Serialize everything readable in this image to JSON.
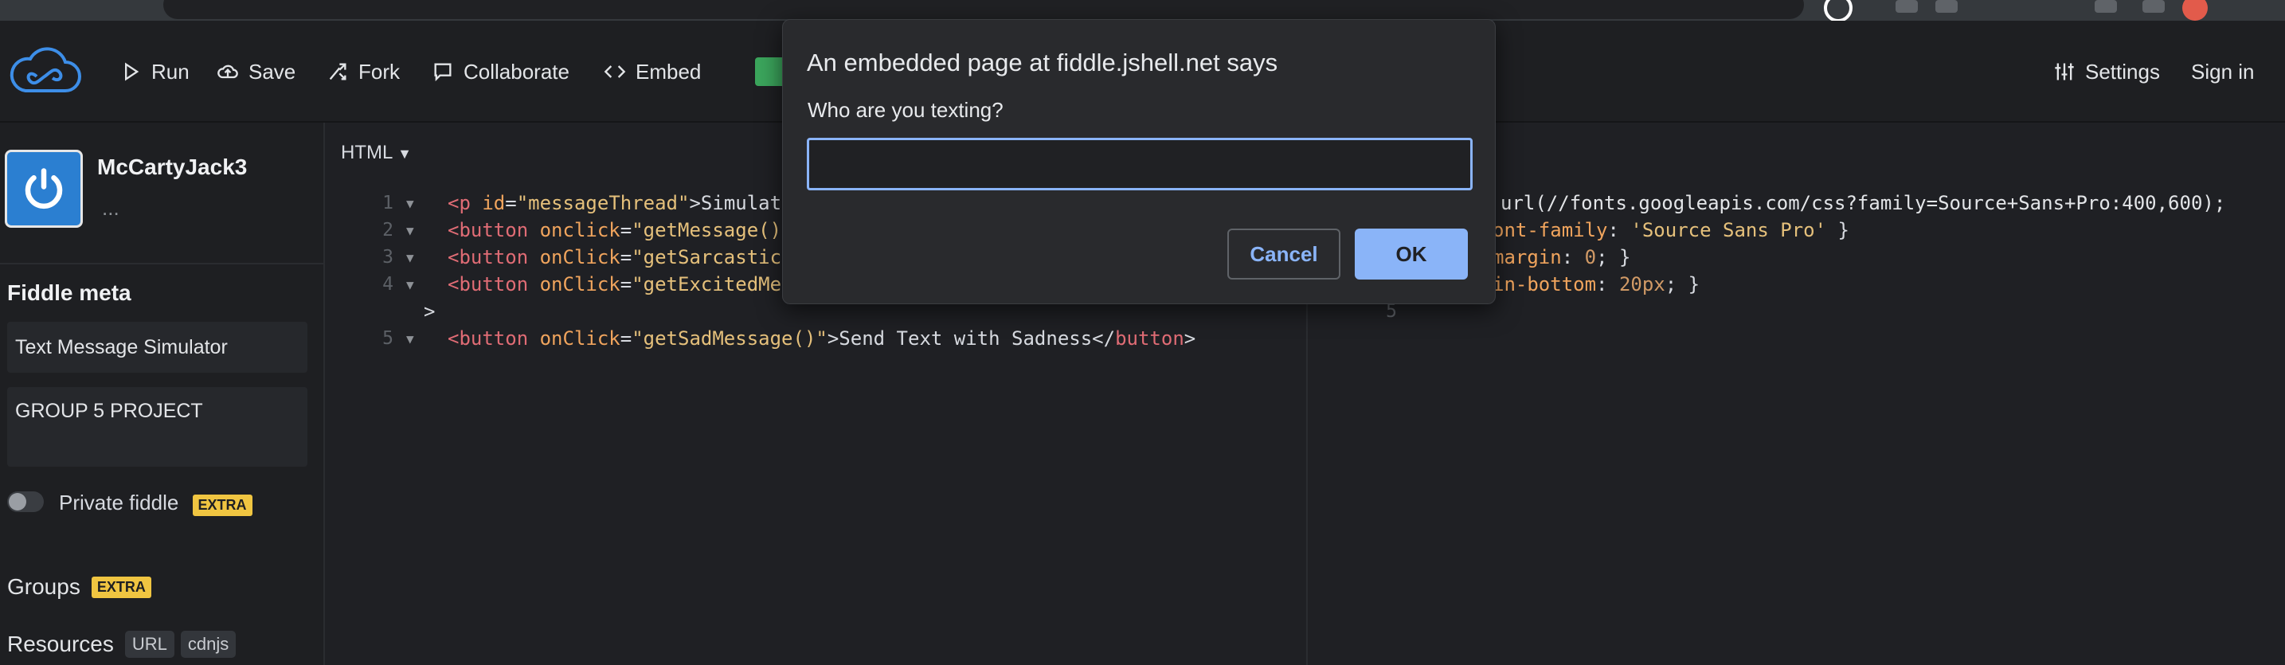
{
  "toolbar": {
    "run": "Run",
    "save": "Save",
    "fork": "Fork",
    "collaborate": "Collaborate",
    "embed": "Embed",
    "settings": "Settings",
    "sign_in": "Sign in"
  },
  "sidebar": {
    "username": "McCartyJack3",
    "user_dots": "...",
    "meta_heading": "Fiddle meta",
    "title_value": "Text Message Simulator",
    "description_value": "GROUP 5 PROJECT",
    "private_label": "Private fiddle",
    "extra_badge": "EXTRA",
    "groups_label": "Groups",
    "resources_label": "Resources",
    "resource_chips": [
      "URL",
      "cdnjs"
    ]
  },
  "html_panel": {
    "label": "HTML",
    "lines": [
      {
        "n": "1",
        "segments": [
          [
            "tag",
            "<p"
          ],
          [
            "attr",
            " id"
          ],
          [
            "txt",
            "="
          ],
          [
            "str",
            "\"messageThread\""
          ],
          [
            "txt",
            ">Simulat"
          ]
        ]
      },
      {
        "n": "2",
        "segments": [
          [
            "tag",
            "<button"
          ],
          [
            "attr",
            " onclick"
          ],
          [
            "txt",
            "="
          ],
          [
            "str",
            "\"getMessage()"
          ]
        ]
      },
      {
        "n": "3",
        "segments": [
          [
            "tag",
            "<button"
          ],
          [
            "attr",
            " onClick"
          ],
          [
            "txt",
            "="
          ],
          [
            "str",
            "\"getSarcastic"
          ]
        ]
      },
      {
        "n": "4",
        "segments": [
          [
            "tag",
            "<button"
          ],
          [
            "attr",
            " onClick"
          ],
          [
            "txt",
            "="
          ],
          [
            "str",
            "\"getExcitedMe"
          ]
        ]
      },
      {
        "n": "",
        "segments": [
          [
            "txt",
            ">"
          ]
        ]
      },
      {
        "n": "5",
        "segments": [
          [
            "tag",
            "<button"
          ],
          [
            "attr",
            " onClick"
          ],
          [
            "txt",
            "="
          ],
          [
            "str",
            "\"getSadMessage()\""
          ],
          [
            "txt",
            ">Send Text with Sadness</"
          ],
          [
            "tag",
            "button"
          ],
          [
            "txt",
            ">"
          ]
        ]
      }
    ]
  },
  "css_panel": {
    "lines": [
      {
        "n": "",
        "segments": [
          [
            "url",
            "url(//fonts.googleapis.com/css?family=Source+Sans+Pro:400,600);"
          ]
        ]
      },
      {
        "n": "",
        "segments": [
          [
            "attr",
            "ont-family"
          ],
          [
            "txt",
            ": "
          ],
          [
            "str",
            "'Source Sans Pro'"
          ],
          [
            "txt",
            " }"
          ]
        ]
      },
      {
        "n": "",
        "segments": [
          [
            "attr",
            "margin"
          ],
          [
            "txt",
            ": "
          ],
          [
            "num",
            "0"
          ],
          [
            "txt",
            "; }"
          ]
        ]
      },
      {
        "n": "",
        "segments": [
          [
            "attr",
            "in-bottom"
          ],
          [
            "txt",
            ": "
          ],
          [
            "num",
            "20px"
          ],
          [
            "txt",
            "; }"
          ]
        ]
      },
      {
        "n": "5",
        "segments": []
      }
    ]
  },
  "dialog": {
    "title": "An embedded page at fiddle.jshell.net says",
    "message": "Who are you texting?",
    "input_value": "",
    "cancel": "Cancel",
    "ok": "OK"
  },
  "colors": {
    "accent_blue": "#8ab4f8",
    "extra_badge": "#f0c541",
    "avatar": "#2b7fd1"
  }
}
